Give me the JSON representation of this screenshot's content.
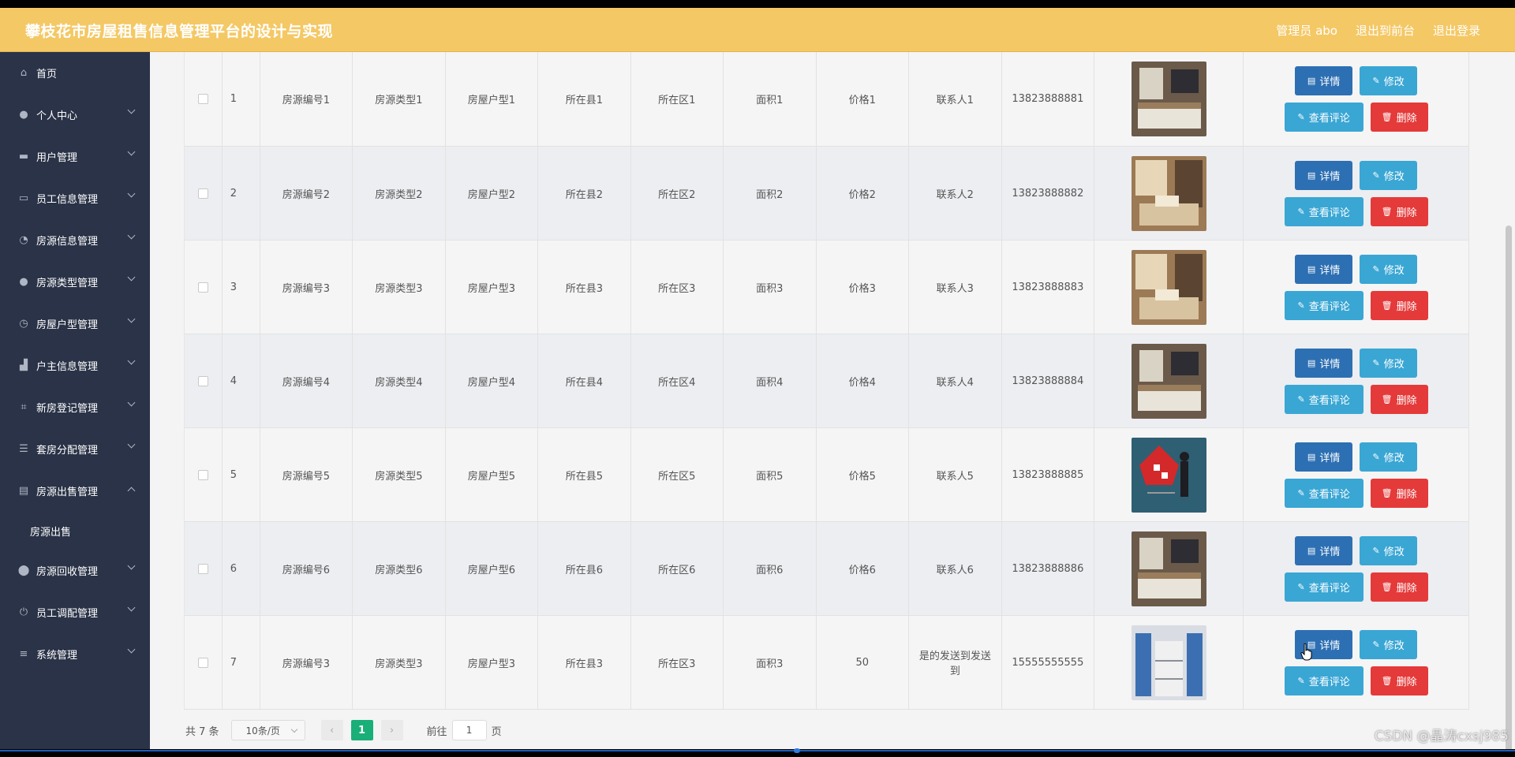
{
  "header": {
    "title": "攀枝花市房屋租售信息管理平台的设计与实现",
    "admin_label": "管理员 abo",
    "exit_front_label": "退出到前台",
    "logout_label": "退出登录"
  },
  "sidebar": {
    "items": [
      {
        "label": "首页",
        "icon": "home-icon",
        "arrow": false
      },
      {
        "label": "个人中心",
        "icon": "user-icon",
        "arrow": true
      },
      {
        "label": "用户管理",
        "icon": "chat-icon",
        "arrow": true
      },
      {
        "label": "员工信息管理",
        "icon": "monitor-icon",
        "arrow": true
      },
      {
        "label": "房源信息管理",
        "icon": "gauge-icon",
        "arrow": true
      },
      {
        "label": "房源类型管理",
        "icon": "user-icon",
        "arrow": true
      },
      {
        "label": "房屋户型管理",
        "icon": "clock-icon",
        "arrow": true
      },
      {
        "label": "户主信息管理",
        "icon": "stamp-icon",
        "arrow": true
      },
      {
        "label": "新房登记管理",
        "icon": "crop-icon",
        "arrow": true
      },
      {
        "label": "套房分配管理",
        "icon": "list-icon",
        "arrow": true
      },
      {
        "label": "房源出售管理",
        "icon": "printer-icon",
        "arrow": true,
        "expanded": true
      },
      {
        "label": "房源回收管理",
        "icon": "location-icon",
        "arrow": true
      },
      {
        "label": "员工调配管理",
        "icon": "power-icon",
        "arrow": true
      },
      {
        "label": "系统管理",
        "icon": "sliders-icon",
        "arrow": true
      }
    ],
    "sub_item": "房源出售"
  },
  "table": {
    "rows": [
      {
        "idx": "1",
        "code": "房源编号1",
        "type": "房源类型1",
        "layout": "房屋户型1",
        "county": "所在县1",
        "district": "所在区1",
        "area": "面积1",
        "price": "价格1",
        "contact": "联系人1",
        "phone": "13823888881",
        "image": "bedroom-photo"
      },
      {
        "idx": "2",
        "code": "房源编号2",
        "type": "房源类型2",
        "layout": "房屋户型2",
        "county": "所在县2",
        "district": "所在区2",
        "area": "面积2",
        "price": "价格2",
        "contact": "联系人2",
        "phone": "13823888882",
        "image": "living-room-photo"
      },
      {
        "idx": "3",
        "code": "房源编号3",
        "type": "房源类型3",
        "layout": "房屋户型3",
        "county": "所在县3",
        "district": "所在区3",
        "area": "面积3",
        "price": "价格3",
        "contact": "联系人3",
        "phone": "13823888883",
        "image": "living-room-photo"
      },
      {
        "idx": "4",
        "code": "房源编号4",
        "type": "房源类型4",
        "layout": "房屋户型4",
        "county": "所在县4",
        "district": "所在区4",
        "area": "面积4",
        "price": "价格4",
        "contact": "联系人4",
        "phone": "13823888884",
        "image": "bedroom-photo"
      },
      {
        "idx": "5",
        "code": "房源编号5",
        "type": "房源类型5",
        "layout": "房屋户型5",
        "county": "所在县5",
        "district": "所在区5",
        "area": "面积5",
        "price": "价格5",
        "contact": "联系人5",
        "phone": "13823888885",
        "image": "red-house-cart-photo"
      },
      {
        "idx": "6",
        "code": "房源编号6",
        "type": "房源类型6",
        "layout": "房屋户型6",
        "county": "所在县6",
        "district": "所在区6",
        "area": "面积6",
        "price": "价格6",
        "contact": "联系人6",
        "phone": "13823888886",
        "image": "bedroom-photo"
      },
      {
        "idx": "7",
        "code": "房源编号3",
        "type": "房源类型3",
        "layout": "房屋户型3",
        "county": "所在县3",
        "district": "所在区3",
        "area": "面积3",
        "price": "50",
        "contact": "是的发送到发送到",
        "phone": "15555555555",
        "image": "dormitory-photo"
      }
    ],
    "buttons": {
      "detail": "详情",
      "edit": "修改",
      "review": "查看评论",
      "delete": "删除"
    }
  },
  "pagination": {
    "total": "共 7 条",
    "page_size": "10条/页",
    "current_page": "1",
    "goto_label": "前往",
    "goto_value": "1",
    "page_unit": "页"
  },
  "watermark": "CSDN @晶涛cxsj985",
  "colors": {
    "header_bg": "#f4c865",
    "sidebar_bg": "#2a3347",
    "detail_btn": "#2d6fb3",
    "edit_btn": "#3aa6d4",
    "delete_btn": "#e53a3a",
    "pager_active": "#1aaf79"
  }
}
